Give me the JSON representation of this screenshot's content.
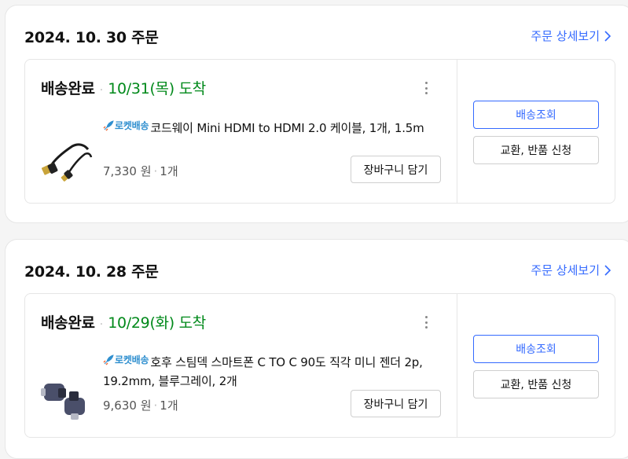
{
  "orders": [
    {
      "date": "2024. 10. 30 주문",
      "detail_link": "주문 상세보기",
      "status": "배송완료",
      "arrival": "10/31(목) 도착",
      "rocket_badge": "로켓배송",
      "product_name": "코드웨이 Mini HDMI to HDMI 2.0 케이블, 1개, 1.5m",
      "price": "7,330 원",
      "quantity": "1개",
      "cart_button": "장바구니 담기",
      "track_button": "배송조회",
      "return_button": "교환, 반품 신청"
    },
    {
      "date": "2024. 10. 28 주문",
      "detail_link": "주문 상세보기",
      "status": "배송완료",
      "arrival": "10/29(화) 도착",
      "rocket_badge": "로켓배송",
      "product_name": "호후 스팀덱 스마트폰 C TO C 90도 직각 미니 젠더 2p, 19.2mm, 블루그레이, 2개",
      "price": "9,630 원",
      "quantity": "1개",
      "cart_button": "장바구니 담기",
      "track_button": "배송조회",
      "return_button": "교환, 반품 신청"
    }
  ],
  "colors": {
    "link": "#346aff",
    "arrival_green": "#00891a",
    "rocket_blue": "#2f8fcf"
  }
}
